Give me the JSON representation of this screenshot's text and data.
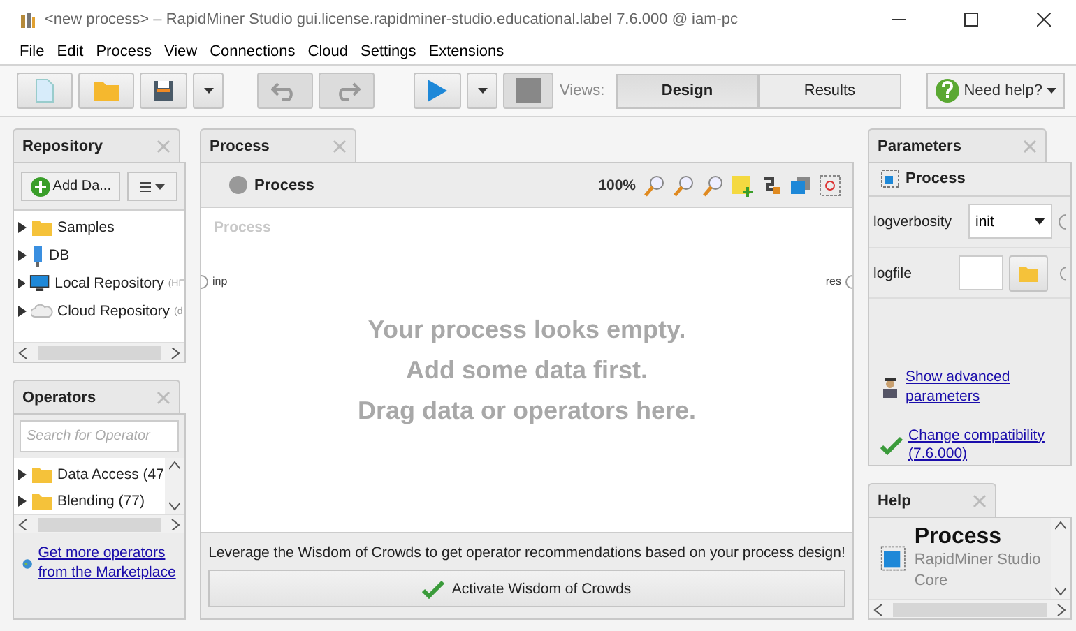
{
  "window": {
    "title": "<new process> – RapidMiner Studio gui.license.rapidminer-studio.educational.label 7.6.000 @ iam-pc"
  },
  "menu": [
    "File",
    "Edit",
    "Process",
    "View",
    "Connections",
    "Cloud",
    "Settings",
    "Extensions"
  ],
  "toolbar": {
    "views_label": "Views:",
    "views": [
      {
        "label": "Design",
        "selected": true
      },
      {
        "label": "Results",
        "selected": false
      }
    ],
    "help_button": "Need help?"
  },
  "repository": {
    "title": "Repository",
    "add_button": "Add Da...",
    "items": [
      {
        "label": "Samples",
        "kind": "folder"
      },
      {
        "label": "DB",
        "kind": "db"
      },
      {
        "label": "Local Repository",
        "hint": "(HF",
        "kind": "monitor"
      },
      {
        "label": "Cloud Repository",
        "hint": "(d",
        "kind": "cloud"
      }
    ]
  },
  "operators": {
    "title": "Operators",
    "search": {
      "placeholder": "Search for Operator"
    },
    "items": [
      {
        "label": "Data Access (47"
      },
      {
        "label": "Blending (77)"
      }
    ],
    "marketplace_link": "Get more operators from the Marketplace"
  },
  "process": {
    "tab": "Process",
    "header": "Process",
    "zoom": "100%",
    "canvas_label": "Process",
    "input_port": "inp",
    "output_port": "res",
    "empty_message": [
      "Your process looks empty.",
      "Add some data first.",
      "Drag data or operators here."
    ],
    "wisdom_text": "Leverage the Wisdom of Crowds to get operator recommendations based on your process design!",
    "wisdom_button": "Activate Wisdom of Crowds"
  },
  "parameters": {
    "title": "Parameters",
    "operator": "Process",
    "params": [
      {
        "kind": "select",
        "name": "logverbosity",
        "value": "init"
      },
      {
        "kind": "file",
        "name": "logfile"
      }
    ],
    "links": [
      {
        "kind": "advanced",
        "label": "Show advanced parameters"
      },
      {
        "kind": "compat",
        "label": "Change compatibility (7.6.000)"
      }
    ]
  },
  "help": {
    "title": "Help",
    "heading": "Process",
    "subtitle": "RapidMiner Studio Core"
  }
}
